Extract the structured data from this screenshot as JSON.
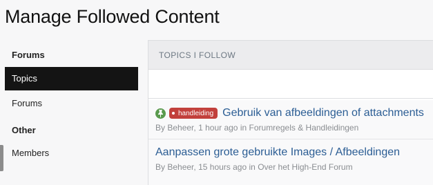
{
  "page": {
    "title": "Manage Followed Content"
  },
  "sidebar": {
    "forums_heading": "Forums",
    "topics_label": "Topics",
    "forums_label": "Forums",
    "other_heading": "Other",
    "members_label": "Members"
  },
  "panel": {
    "header": "TOPICS I FOLLOW"
  },
  "topics": [
    {
      "pinned": true,
      "prefix": "handleiding",
      "title": "Gebruik van afbeeldingen of attachments",
      "by": "By",
      "author": "Beheer",
      "time": "1 hour ago",
      "in": "in",
      "forum": "Forumregels & Handleidingen"
    },
    {
      "pinned": false,
      "prefix": "",
      "title": "Aanpassen grote gebruikte Images / Afbeeldingen",
      "by": "By",
      "author": "Beheer",
      "time": "15 hours ago",
      "in": "in",
      "forum": "Over het High-End Forum"
    }
  ],
  "colors": {
    "active_bg": "#141414",
    "link": "#2b5d94",
    "badge": "#c2403c",
    "pin": "#5a9a4e"
  }
}
